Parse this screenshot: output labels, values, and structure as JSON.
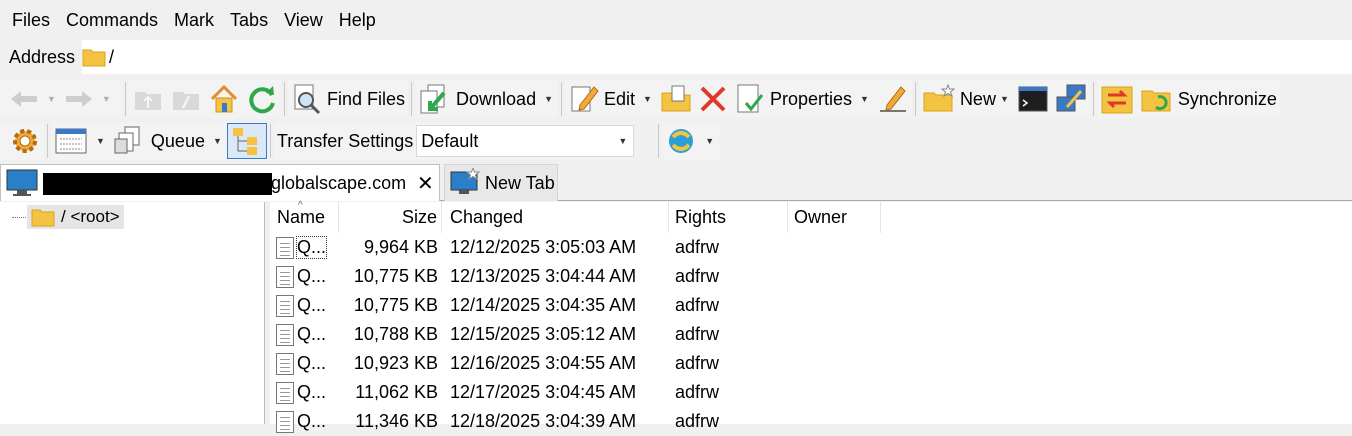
{
  "menu": [
    "Files",
    "Commands",
    "Mark",
    "Tabs",
    "View",
    "Help"
  ],
  "address": {
    "label": "Address",
    "value": "/"
  },
  "toolbar1": {
    "find_files": "Find Files",
    "download": "Download",
    "edit": "Edit",
    "properties": "Properties",
    "new": "New",
    "synchronize": "Synchronize"
  },
  "toolbar2": {
    "queue": "Queue",
    "transfer_settings": "Transfer Settings",
    "transfer_preset": "Default"
  },
  "tabs": {
    "active_visible": "globalscape.com",
    "new_tab": "New Tab"
  },
  "tree": {
    "root": "/ <root>"
  },
  "columns": [
    "Name",
    "Size",
    "Changed",
    "Rights",
    "Owner"
  ],
  "files": [
    {
      "name": "Q...",
      "size": "9,964 KB",
      "changed": "12/12/2025 3:05:03 AM",
      "rights": "adfrw",
      "owner": ""
    },
    {
      "name": "Q...",
      "size": "10,775 KB",
      "changed": "12/13/2025 3:04:44 AM",
      "rights": "adfrw",
      "owner": ""
    },
    {
      "name": "Q...",
      "size": "10,775 KB",
      "changed": "12/14/2025 3:04:35 AM",
      "rights": "adfrw",
      "owner": ""
    },
    {
      "name": "Q...",
      "size": "10,788 KB",
      "changed": "12/15/2025 3:05:12 AM",
      "rights": "adfrw",
      "owner": ""
    },
    {
      "name": "Q...",
      "size": "10,923 KB",
      "changed": "12/16/2025 3:04:55 AM",
      "rights": "adfrw",
      "owner": ""
    },
    {
      "name": "Q...",
      "size": "11,062 KB",
      "changed": "12/17/2025 3:04:45 AM",
      "rights": "adfrw",
      "owner": ""
    },
    {
      "name": "Q...",
      "size": "11,346 KB",
      "changed": "12/18/2025 3:04:39 AM",
      "rights": "adfrw",
      "owner": ""
    }
  ],
  "colors": {
    "folder": "#f5c342",
    "sync_green": "#2ea84a",
    "delete_red": "#e0392b",
    "selection": "#e5e5e5"
  }
}
